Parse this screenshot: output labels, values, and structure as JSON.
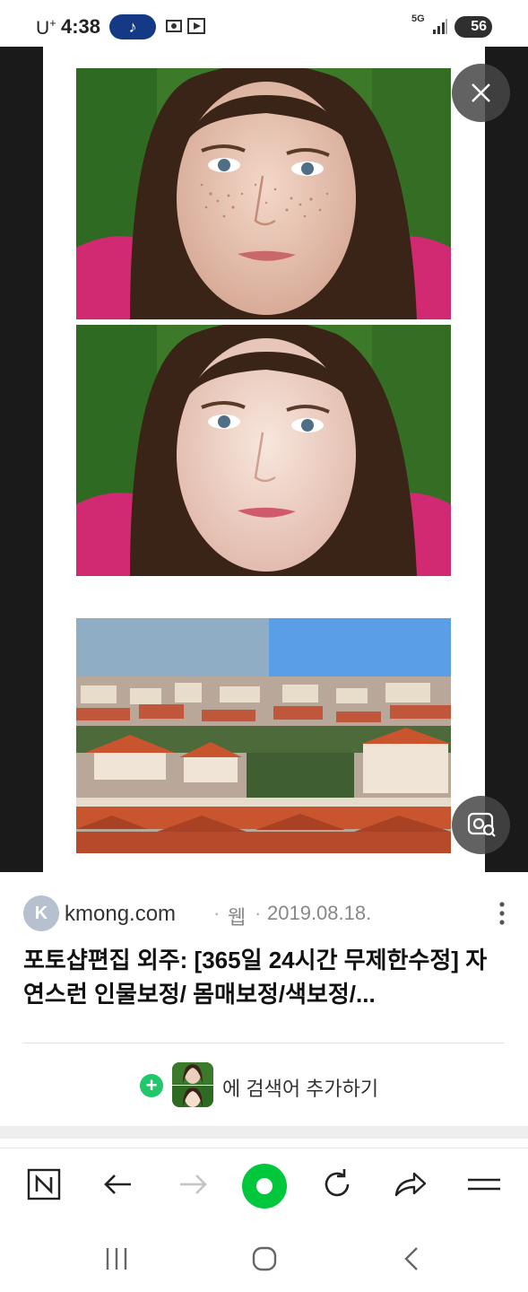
{
  "status_bar": {
    "carrier": "U",
    "carrier_sup": "+",
    "time": "4:38",
    "music_icon": "music-note-icon",
    "network": "5G",
    "battery": "56"
  },
  "viewer": {
    "close_icon": "close-icon",
    "lens_icon": "image-search-icon"
  },
  "result": {
    "favicon_letter": "K",
    "domain": "kmong.com",
    "separator": "·",
    "type": "웹",
    "date": "2019.08.18.",
    "title": "포토샵편집 외주: [365일 24시간 무제한수정] 자연스런 인물보정/ 몸매보정/색보정/...",
    "add_plus": "+",
    "add_search_text": "에 검색어 추가하기"
  },
  "toolbar": {
    "items": [
      "naver-n-icon",
      "back-arrow-icon",
      "forward-arrow-icon",
      "home-green-icon",
      "reload-icon",
      "share-icon",
      "menu-icon"
    ]
  },
  "colors": {
    "accent_green": "#00c73c",
    "pill_blue": "#143a86",
    "viewer_bg": "#1a1a1a"
  }
}
